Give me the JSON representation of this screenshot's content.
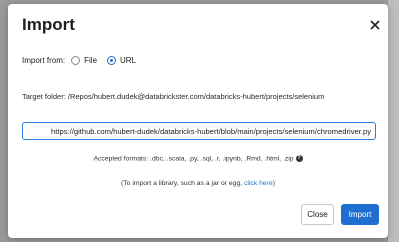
{
  "dialog": {
    "title": "Import",
    "import_from_label": "Import from:",
    "options": [
      {
        "label": "File",
        "selected": false
      },
      {
        "label": "URL",
        "selected": true
      }
    ],
    "target_folder": "Target folder: /Repos/hubert.dudek@databrickster.com/databricks-hubert/projects/selenium",
    "url_value": "https://github.com/hubert-dudek/databricks-hubert/blob/main/projects/selenium/chromedriver.py",
    "accepted_formats": "Accepted formats: .dbc, .scala, .py, .sql, .r, .ipynb, .Rmd, .html, .zip",
    "library_prefix": "(To import a library, such as a jar or egg,",
    "library_link": "click here",
    "library_suffix": ")",
    "close_button": "Close",
    "import_button": "Import"
  },
  "colors": {
    "accent": "#1f6fd0",
    "overlay": "#9a9a9a"
  }
}
